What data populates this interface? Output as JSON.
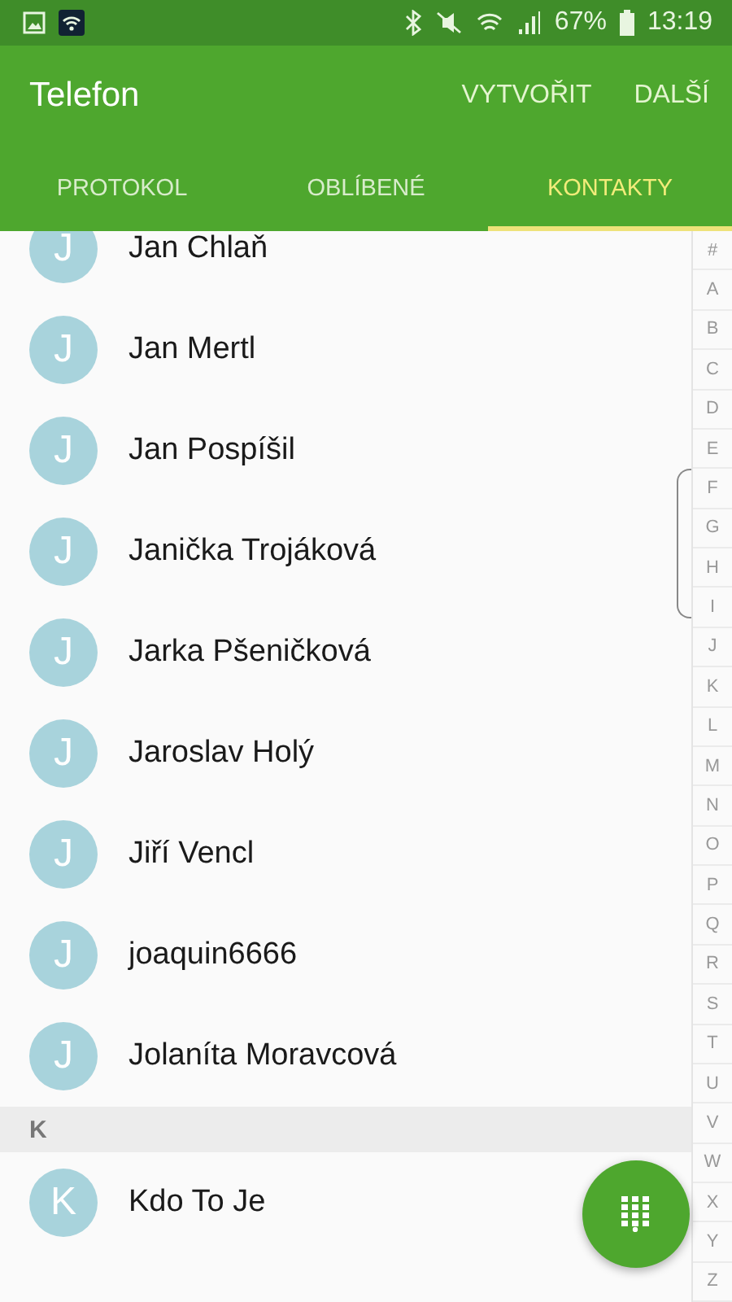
{
  "status_bar": {
    "battery": "67%",
    "time": "13:19"
  },
  "app_bar": {
    "title": "Telefon",
    "actions": [
      "VYTVOŘIT",
      "DALŠÍ"
    ]
  },
  "tabs": [
    {
      "label": "PROTOKOL",
      "selected": false
    },
    {
      "label": "OBLÍBENÉ",
      "selected": false
    },
    {
      "label": "KONTAKTY",
      "selected": true
    }
  ],
  "contacts": [
    {
      "kind": "contact",
      "initial": "J",
      "name": "Jan Chlaň"
    },
    {
      "kind": "contact",
      "initial": "J",
      "name": "Jan Mertl"
    },
    {
      "kind": "contact",
      "initial": "J",
      "name": "Jan Pospíšil"
    },
    {
      "kind": "contact",
      "initial": "J",
      "name": "Janička Trojáková"
    },
    {
      "kind": "contact",
      "initial": "J",
      "name": "Jarka Pšeničková"
    },
    {
      "kind": "contact",
      "initial": "J",
      "name": "Jaroslav Holý"
    },
    {
      "kind": "contact",
      "initial": "J",
      "name": "Jiří Vencl"
    },
    {
      "kind": "contact",
      "initial": "J",
      "name": "joaquin6666"
    },
    {
      "kind": "contact",
      "initial": "J",
      "name": "Jolaníta Moravcová"
    },
    {
      "kind": "header",
      "label": "K"
    },
    {
      "kind": "contact",
      "initial": "K",
      "name": "Kdo To Je"
    }
  ],
  "index": [
    "#",
    "A",
    "B",
    "C",
    "D",
    "E",
    "F",
    "G",
    "H",
    "I",
    "J",
    "K",
    "L",
    "M",
    "N",
    "O",
    "P",
    "Q",
    "R",
    "S",
    "T",
    "U",
    "V",
    "W",
    "X",
    "Y",
    "Z"
  ]
}
